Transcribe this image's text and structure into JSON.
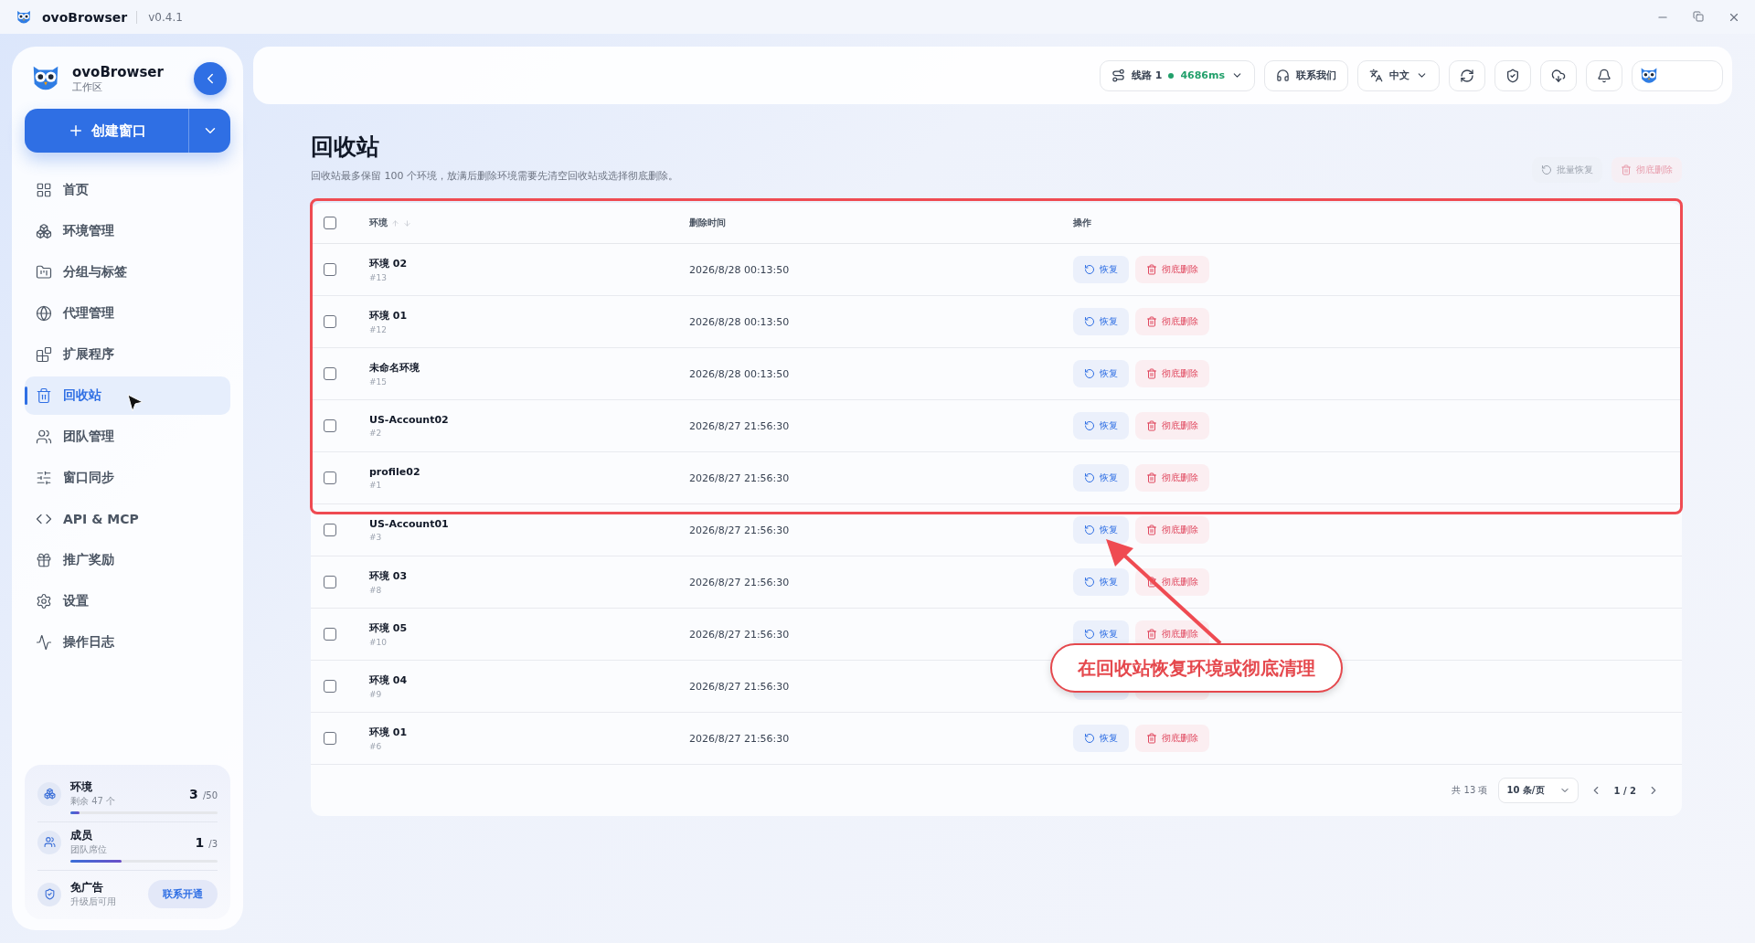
{
  "titlebar": {
    "app_name": "ovoBrowser",
    "version": "v0.4.1"
  },
  "sidebar": {
    "brand": "ovoBrowser",
    "workspace": "工作区",
    "create_button": "创建窗口",
    "items": [
      {
        "kind": "home",
        "label": "首页",
        "selected": false
      },
      {
        "kind": "env",
        "label": "环境管理",
        "selected": false
      },
      {
        "kind": "group",
        "label": "分组与标签",
        "selected": false
      },
      {
        "kind": "proxy",
        "label": "代理管理",
        "selected": false
      },
      {
        "kind": "ext",
        "label": "扩展程序",
        "selected": false
      },
      {
        "kind": "trash",
        "label": "回收站",
        "selected": true
      },
      {
        "kind": "team",
        "label": "团队管理",
        "selected": false
      },
      {
        "kind": "sync",
        "label": "窗口同步",
        "selected": false
      },
      {
        "kind": "api",
        "label": "API & MCP",
        "selected": false
      },
      {
        "kind": "gift",
        "label": "推广奖励",
        "selected": false
      },
      {
        "kind": "settings",
        "label": "设置",
        "selected": false
      },
      {
        "kind": "log",
        "label": "操作日志",
        "selected": false
      }
    ],
    "usage": [
      {
        "kind": "env",
        "name": "环境",
        "sub": "剩余 47 个",
        "count": "3",
        "total": "/50",
        "level": 0.06
      },
      {
        "kind": "members",
        "name": "成员",
        "sub": "团队席位",
        "count": "1",
        "total": "/3",
        "level": 0.35
      }
    ],
    "ad_free": {
      "name": "免广告",
      "sub": "升级后可用",
      "button": "联系开通"
    }
  },
  "topbar": {
    "route": {
      "label": "线路 1",
      "latency": "4686ms"
    },
    "contact": "联系我们",
    "language": "中文"
  },
  "page": {
    "title": "回收站",
    "description": "回收站最多保留 100 个环境，放满后删除环境需要先清空回收站或选择彻底删除。",
    "actions": [
      {
        "kind": "restore",
        "label": "批量恢复",
        "disabled": true
      },
      {
        "kind": "delete",
        "label": "彻底删除",
        "disabled": true
      }
    ]
  },
  "table": {
    "select_all": false,
    "columns": [
      "环境",
      "删除时间",
      "操作"
    ],
    "rows": [
      {
        "name": "环境 02",
        "id": "#13",
        "time": "2026/8/28 00:13:50",
        "restore": "恢复",
        "delete": "彻底删除",
        "selected": false
      },
      {
        "name": "环境 01",
        "id": "#12",
        "time": "2026/8/28 00:13:50",
        "restore": "恢复",
        "delete": "彻底删除",
        "selected": false
      },
      {
        "name": "未命名环境",
        "id": "#15",
        "time": "2026/8/28 00:13:50",
        "restore": "恢复",
        "delete": "彻底删除",
        "selected": false
      },
      {
        "name": "US-Account02",
        "id": "#2",
        "time": "2026/8/27 21:56:30",
        "restore": "恢复",
        "delete": "彻底删除",
        "selected": false
      },
      {
        "name": "profile02",
        "id": "#1",
        "time": "2026/8/27 21:56:30",
        "restore": "恢复",
        "delete": "彻底删除",
        "selected": false
      },
      {
        "name": "US-Account01",
        "id": "#3",
        "time": "2026/8/27 21:56:30",
        "restore": "恢复",
        "delete": "彻底删除",
        "selected": false
      },
      {
        "name": "环境 03",
        "id": "#8",
        "time": "2026/8/27 21:56:30",
        "restore": "恢复",
        "delete": "彻底删除",
        "selected": false
      },
      {
        "name": "环境 05",
        "id": "#10",
        "time": "2026/8/27 21:56:30",
        "restore": "恢复",
        "delete": "彻底删除",
        "selected": false
      },
      {
        "name": "环境 04",
        "id": "#9",
        "time": "2026/8/27 21:56:30",
        "selected": false
      },
      {
        "name": "环境 01",
        "id": "#6",
        "time": "2026/8/27 21:56:30",
        "restore": "恢复",
        "delete": "彻底删除",
        "selected": false
      }
    ],
    "pagination": {
      "total": "共 13 项",
      "page_size": "10 条/页",
      "page": "1 / 2"
    }
  },
  "annotation": {
    "text": "在回收站恢复环境或彻底清理"
  }
}
